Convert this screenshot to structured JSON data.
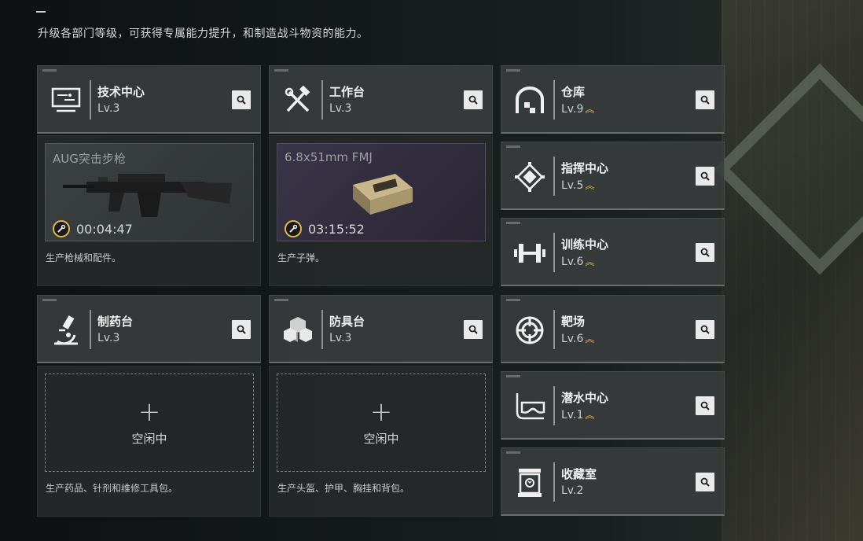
{
  "subtitle": "升级各部门等级，可获得专属能力提升，和制造战斗物资的能力。",
  "departments": [
    {
      "name": "技术中心",
      "level": "Lv.3",
      "icon": "monitor-icon"
    },
    {
      "name": "工作台",
      "level": "Lv.3",
      "icon": "hammer-wrench-icon"
    },
    {
      "name": "仓库",
      "level": "Lv.9",
      "icon": "warehouse-icon",
      "upgrade": "︽"
    },
    {
      "name": "指挥中心",
      "level": "Lv.5",
      "icon": "chip-icon",
      "upgrade": "︽"
    },
    {
      "name": "训练中心",
      "level": "Lv.6",
      "icon": "dumbbell-icon",
      "upgrade": "︽"
    },
    {
      "name": "制药台",
      "level": "Lv.3",
      "icon": "microscope-icon"
    },
    {
      "name": "防具台",
      "level": "Lv.3",
      "icon": "cubes-icon"
    },
    {
      "name": "靶场",
      "level": "Lv.6",
      "icon": "target-icon",
      "upgrade": "︽"
    },
    {
      "name": "潜水中心",
      "level": "Lv.1",
      "icon": "diving-mask-icon",
      "upgrade": "︽"
    },
    {
      "name": "收藏室",
      "level": "Lv.2",
      "icon": "display-case-icon"
    }
  ],
  "production": {
    "tech": {
      "item": "AUG突击步枪",
      "timer": "00:04:47",
      "desc": "生产枪械和配件。"
    },
    "workbench": {
      "item": "6.8x51mm FMJ",
      "timer": "03:15:52",
      "desc": "生产子弹。"
    },
    "pharma": {
      "idle_label": "空闲中",
      "plus": "+",
      "desc": "生产药品、针剂和维修工具包。"
    },
    "armor": {
      "idle_label": "空闲中",
      "plus": "+",
      "desc": "生产头盔、护甲、胸挂和背包。"
    }
  },
  "colors": {
    "accent": "#e2b94a",
    "panel": "#3a3e3e"
  }
}
